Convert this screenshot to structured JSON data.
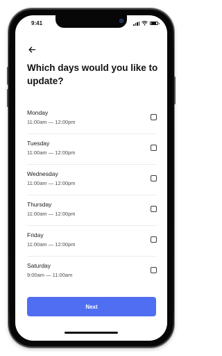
{
  "status_bar": {
    "time": "9:41"
  },
  "header": {
    "back_icon": "arrow-left-icon",
    "title": "Which days would you like to update?"
  },
  "days": [
    {
      "name": "Monday",
      "time": "11:00am — 12:00pm",
      "checked": false
    },
    {
      "name": "Tuesday",
      "time": "11:00am — 12:00pm",
      "checked": false
    },
    {
      "name": "Wednesday",
      "time": "11:00am — 12:00pm",
      "checked": false
    },
    {
      "name": "Thursday",
      "time": "11:00am — 12:00pm",
      "checked": false
    },
    {
      "name": "Friday",
      "time": "11:00am — 12:00pm",
      "checked": false
    },
    {
      "name": "Saturday",
      "time": "9:00am — 11:00am",
      "checked": false
    }
  ],
  "footer": {
    "next_label": "Next"
  },
  "colors": {
    "accent": "#4f6ef2",
    "text": "#121212",
    "divider": "#ececec"
  }
}
